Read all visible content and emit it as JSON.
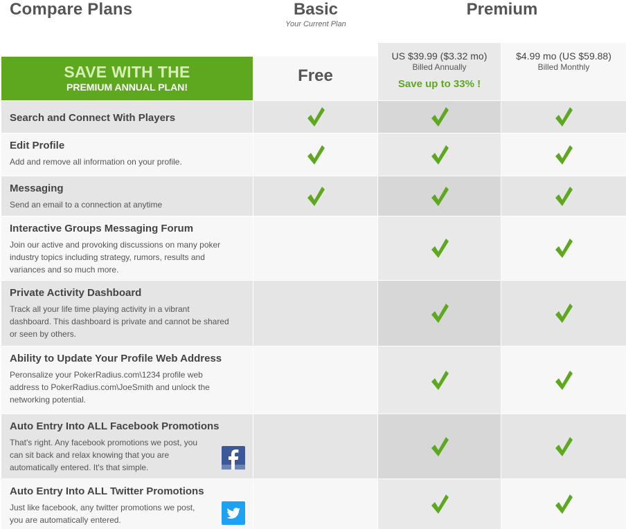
{
  "header": {
    "title": "Compare Plans",
    "basic": {
      "name": "Basic",
      "subtitle": "Your Current Plan"
    },
    "premium": {
      "name": "Premium"
    }
  },
  "banner": {
    "line1": "SAVE WITH THE",
    "line2": "PREMIUM ANNUAL PLAN!"
  },
  "plans": {
    "basic_price": "Free",
    "annual": {
      "price": "US $39.99 ($3.32 mo)",
      "billing": "Billed Annually",
      "savings": "Save up to 33% !"
    },
    "monthly": {
      "price": "$4.99 mo (US $59.88)",
      "billing": "Billed Monthly"
    }
  },
  "colors": {
    "accent": "#5ea820",
    "check": "#5ea820",
    "facebook": "#3b5998",
    "twitter": "#1da1f2"
  },
  "features": [
    {
      "title": "Search and Connect With Players",
      "desc": "",
      "basic": true,
      "annual": true,
      "monthly": true
    },
    {
      "title": "Edit Profile",
      "desc": "Add and remove all information on your profile.",
      "basic": true,
      "annual": true,
      "monthly": true
    },
    {
      "title": "Messaging",
      "desc": "Send an email to a connection at anytime",
      "basic": true,
      "annual": true,
      "monthly": true
    },
    {
      "title": "Interactive Groups Messaging Forum",
      "desc": "Join our active and provoking discussions on many poker industry topics including strategy, rumors, results and variances and so much more.",
      "basic": false,
      "annual": true,
      "monthly": true
    },
    {
      "title": "Private Activity Dashboard",
      "desc": "Track all your life time playing activity in a vibrant dashboard. This dashboard is private and cannot be shared or seen by others.",
      "basic": false,
      "annual": true,
      "monthly": true
    },
    {
      "title": "Ability to Update Your Profile Web Address",
      "desc": "Peronsalize your PokerRadius.com\\1234 profile web address to PokerRadius.com\\JoeSmith and unlock the networking potential.",
      "basic": false,
      "annual": true,
      "monthly": true
    },
    {
      "title": "Auto Entry Into ALL Facebook Promotions",
      "desc": "That's right. Any facebook promotions we post, you can sit back and relax knowing that you are automatically entered. It's that simple.",
      "basic": false,
      "annual": true,
      "monthly": true,
      "icon": "facebook-icon"
    },
    {
      "title": "Auto Entry Into ALL Twitter Promotions",
      "desc": "Just like facebook, any twitter promotions we post, you are automatically entered.",
      "basic": false,
      "annual": true,
      "monthly": true,
      "icon": "twitter-icon"
    }
  ]
}
